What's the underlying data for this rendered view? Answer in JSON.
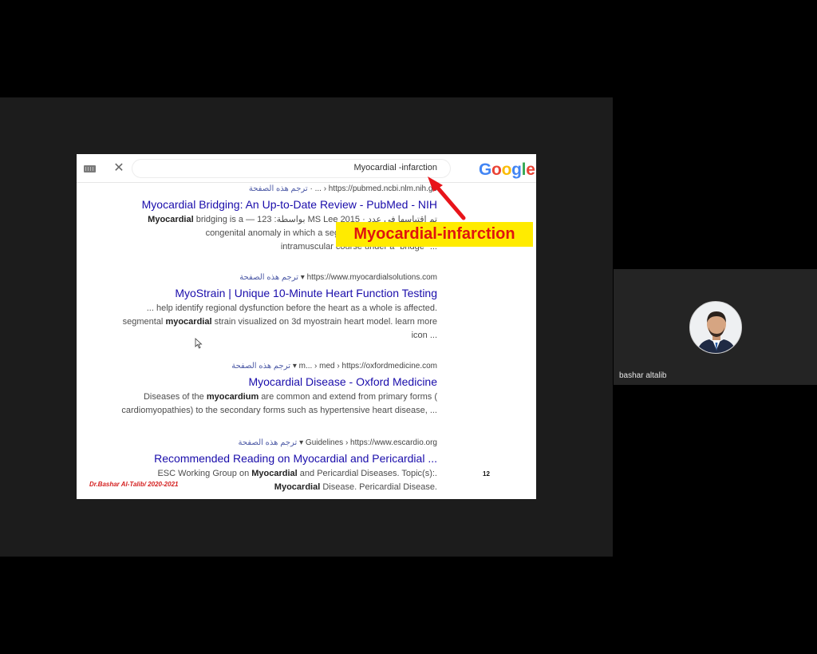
{
  "slide": {
    "search": {
      "query": "Myocardial -infarction"
    },
    "google_logo": {
      "letters": [
        "G",
        "o",
        "o",
        "g",
        "l",
        "e"
      ],
      "colors": [
        "#4285F4",
        "#EA4335",
        "#FBBC05",
        "#4285F4",
        "#34A853",
        "#EA4335"
      ]
    },
    "results": [
      {
        "breadcrumb_ar": "ترجم هذه الصفحة",
        "breadcrumb": "· ... › https://pubmed.ncbi.nlm.nih.go",
        "title": "Myocardial Bridging: An Up-to-Date Review - PubMed - NIH",
        "snippet_lines": [
          {
            "bold": "Myocardial",
            "text": " bridging is a — 123 :بواسطة MS Lee 2015 · تم اقتباسها في عدد"
          },
          {
            "bold": "",
            "text": "congenital anomaly in which a segment of a coronary artery"
          },
          {
            "bold": "",
            "text": "intramuscular course under a \"bridge\" ..."
          }
        ]
      },
      {
        "breadcrumb_ar": "ترجم هذه الصفحة",
        "breadcrumb": "▾ https://www.myocardialsolutions.com",
        "title": "MyoStrain | Unique 10-Minute Heart Function Testing",
        "snippet_lines": [
          {
            "bold": "",
            "text": "... help identify regional dysfunction before the heart as a whole is affected."
          },
          {
            "bold": "myocardial",
            "text_before": "segmental ",
            "text": " strain visualized on 3d myostrain heart model. learn more"
          },
          {
            "bold": "",
            "text": "icon ..."
          }
        ]
      },
      {
        "breadcrumb_ar": "ترجم هذه الصفحة",
        "breadcrumb": "▾ m... › med › https://oxfordmedicine.com",
        "title": "Myocardial Disease - Oxford Medicine",
        "snippet_lines": [
          {
            "bold": "myocardium",
            "text_before": "Diseases of the ",
            "text": " are common and extend from primary forms ("
          },
          {
            "bold": "",
            "text": "cardiomyopathies) to the secondary forms such as hypertensive heart disease, ..."
          }
        ]
      },
      {
        "breadcrumb_ar": "ترجم هذه الصفحة",
        "breadcrumb": "▾ Guidelines › https://www.escardio.org",
        "title": "Recommended Reading on Myocardial and Pericardial ...",
        "snippet_lines": [
          {
            "bold": "Myocardial",
            "text_before": "ESC Working Group on ",
            "text": " and Pericardial Diseases. Topic(s):."
          },
          {
            "bold": "Myocardial",
            "text_before": "",
            "text": " Disease. Pericardial Disease."
          }
        ]
      }
    ],
    "annotation": "Myocardial-infarction",
    "footer_author": "Dr.Bashar Al-Talib/ 2020-2021",
    "page_number": "12"
  },
  "participant": {
    "name": "bashar altalib"
  },
  "colors": {
    "link": "#1a0dab",
    "annotation_bg": "#ffeb00",
    "annotation_text": "#e0140f",
    "arrow": "#e8141a"
  }
}
